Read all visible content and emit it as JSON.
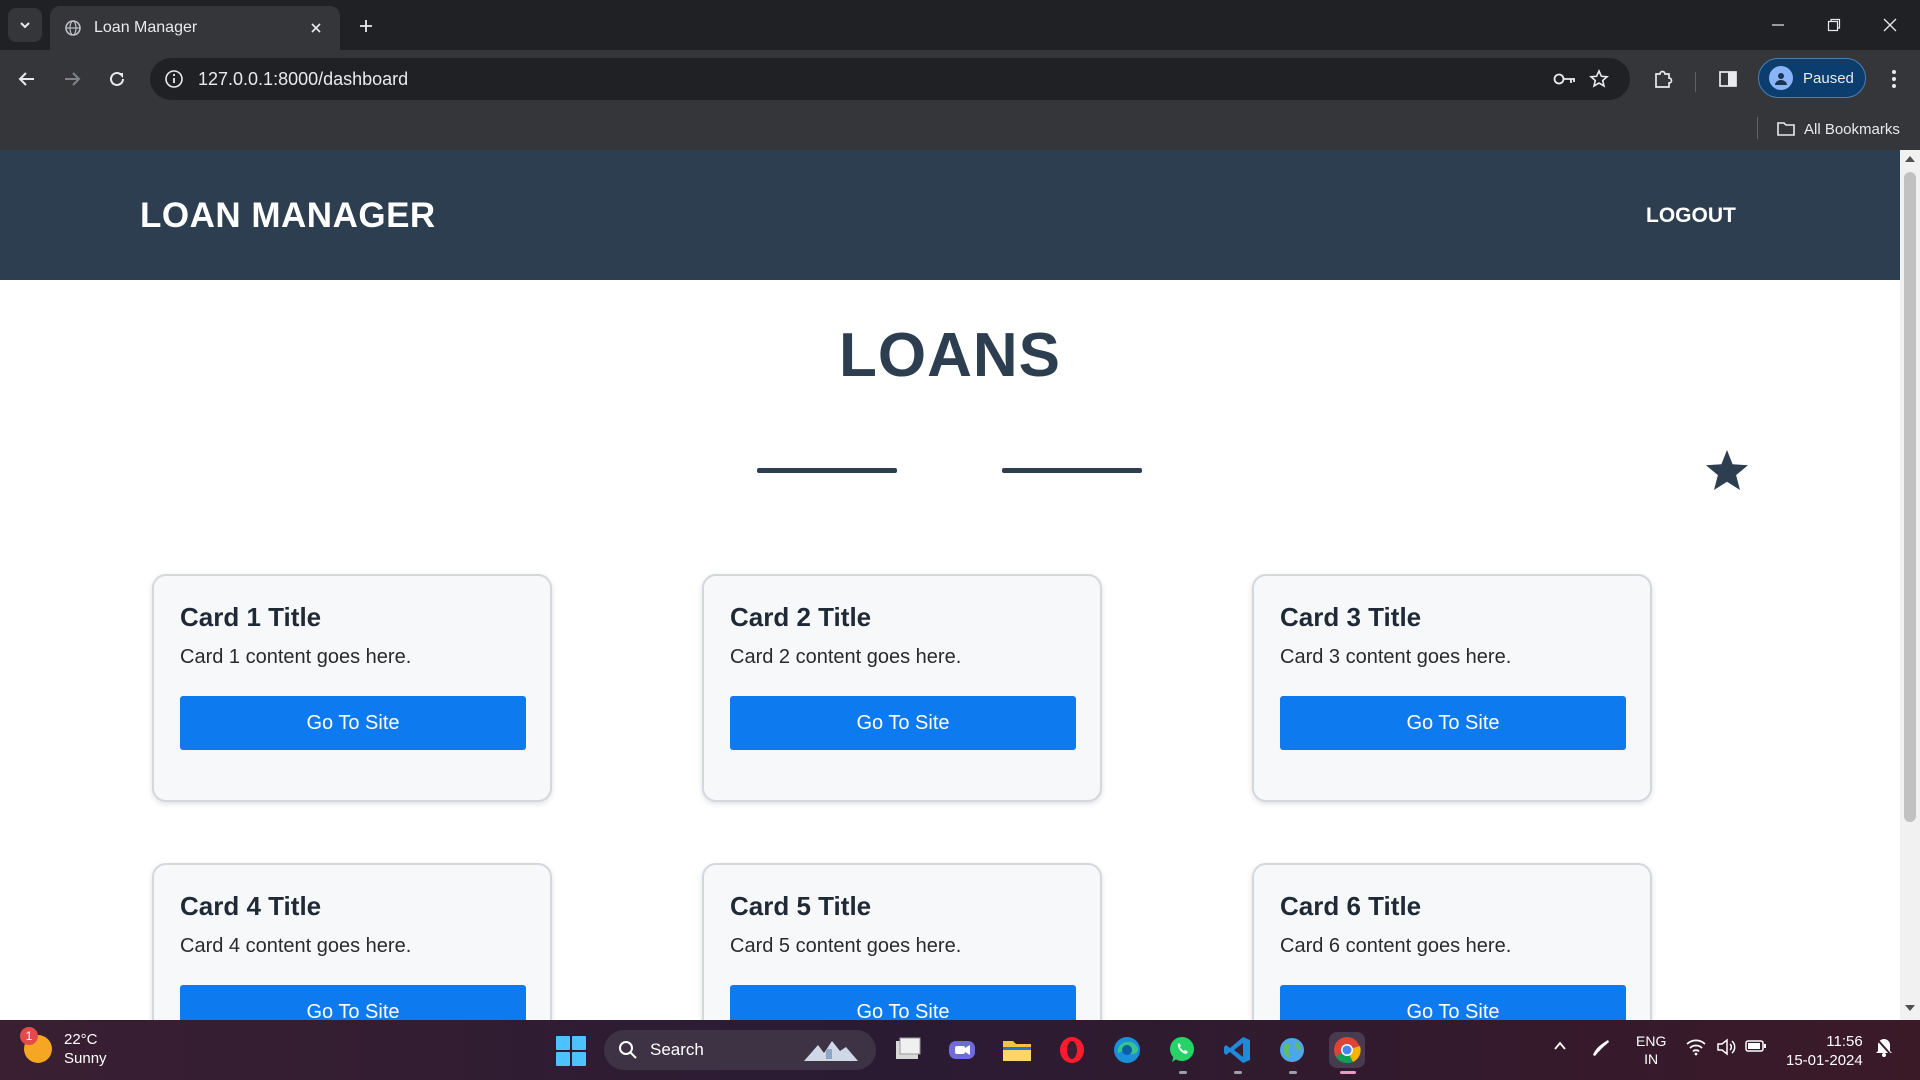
{
  "browser": {
    "tab_title": "Loan Manager",
    "url": "127.0.0.1:8000/dashboard",
    "profile_label": "Paused",
    "bookmarks_label": "All Bookmarks"
  },
  "site": {
    "brand": "LOAN MANAGER",
    "logout": "LOGOUT",
    "page_title": "LOANS"
  },
  "cards": [
    {
      "title": "Card 1 Title",
      "text": "Card 1 content goes here.",
      "button": "Go To Site"
    },
    {
      "title": "Card 2 Title",
      "text": "Card 2 content goes here.",
      "button": "Go To Site"
    },
    {
      "title": "Card 3 Title",
      "text": "Card 3 content goes here.",
      "button": "Go To Site"
    },
    {
      "title": "Card 4 Title",
      "text": "Card 4 content goes here.",
      "button": "Go To Site"
    },
    {
      "title": "Card 5 Title",
      "text": "Card 5 content goes here.",
      "button": "Go To Site"
    },
    {
      "title": "Card 6 Title",
      "text": "Card 6 content goes here.",
      "button": "Go To Site"
    }
  ],
  "taskbar": {
    "weather_temp": "22°C",
    "weather_desc": "Sunny",
    "weather_badge": "1",
    "search_label": "Search",
    "lang_line1": "ENG",
    "lang_line2": "IN",
    "time": "11:56",
    "date": "15-01-2024",
    "apps": [
      "file-manager-icon",
      "video-call-icon",
      "file-explorer-icon",
      "opera-icon",
      "edge-icon",
      "whatsapp-icon",
      "vscode-icon",
      "browser-globe-icon",
      "chrome-icon"
    ]
  },
  "colors": {
    "header_bg": "#2c3e50",
    "button_blue": "#0d7aef",
    "card_bg": "#f7f8fa"
  }
}
